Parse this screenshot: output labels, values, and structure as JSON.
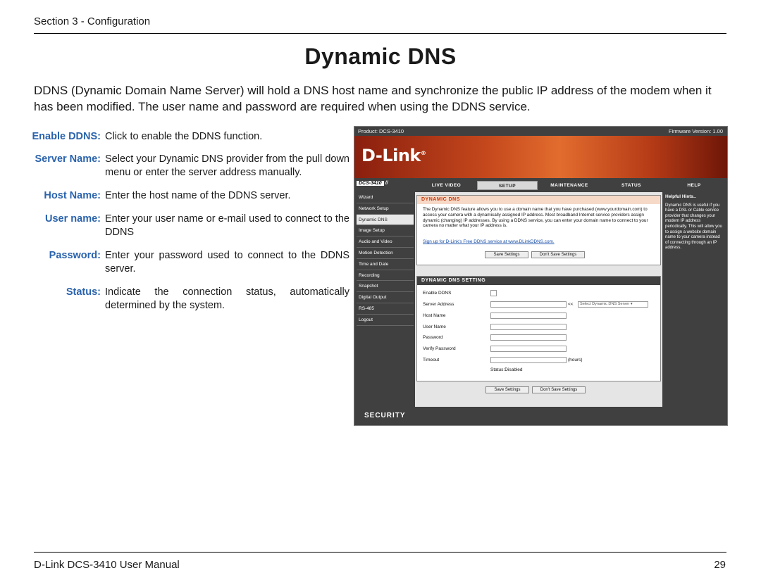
{
  "header": {
    "section": "Section 3 - Configuration"
  },
  "title": "Dynamic DNS",
  "intro": "DDNS (Dynamic Domain Name Server) will hold a DNS host name and synchronize the public IP address of the modem when it has been modified. The user name and password are required when using the DDNS service.",
  "fields": [
    {
      "label": "Enable DDNS:",
      "desc": "Click to enable the DDNS function."
    },
    {
      "label": "Server Name:",
      "desc": "Select your Dynamic DNS provider from the pull down menu or enter the server address manually."
    },
    {
      "label": "Host Name:",
      "desc": "Enter the host name of the DDNS server."
    },
    {
      "label": "User name:",
      "desc": "Enter your user name or e-mail used to connect to the DDNS"
    },
    {
      "label": "Password:",
      "desc": "Enter your password used to connect to the DDNS server."
    },
    {
      "label": "Status:",
      "desc": "Indicate the connection status, automatically determined by the system."
    }
  ],
  "screenshot": {
    "product": "Product: DCS-3410",
    "firmware": "Firmware Version: 1.00",
    "logo": "D-Link",
    "model": "DCS-3410",
    "tabs": [
      "LIVE VIDEO",
      "SETUP",
      "MAINTENANCE",
      "STATUS",
      "HELP"
    ],
    "sidebar": [
      "Wizard",
      "Network Setup",
      "Dynamic DNS",
      "Image Setup",
      "Audio and Video",
      "Motion Detection",
      "Time and Date",
      "Recording",
      "Snapshot",
      "Digital Output",
      "RS-485",
      "Logout"
    ],
    "panel_title": "DYNAMIC DNS",
    "panel_text": "The Dynamic DNS feature allows you to use a domain name that you have purchased (www.yourdomain.com) to access your camera with a dynamically assigned IP address. Most broadband Internet service providers assign dynamic (changing) IP addresses. By using a DDNS service, you can enter your domain name to connect to your camera no matter what your IP address is.",
    "signup_link": "Sign up for D-Link's Free DDNS service at www.DLinkDDNS.com.",
    "save_button": "Save Settings",
    "dont_save_button": "Don't Save Settings",
    "setting_title": "DYNAMIC DNS SETTING",
    "labels": {
      "enable": "Enable DDNS",
      "server": "Server Address",
      "host": "Host Name",
      "user": "User Name",
      "password": "Password",
      "verify": "Verify Password",
      "timeout": "Timeout"
    },
    "server_select": "Select Dynamic DNS Server",
    "arrows": "<<",
    "hours": "(hours)",
    "status": "Status:Disabled",
    "help_title": "Helpful Hints..",
    "help_text": "Dynamic DNS is useful if you have a DSL or Cable service provider that changes your modem IP address periodically. This will allow you to assign a website domain name to your camera instead of connecting through an IP address.",
    "footer_brand": "SECURITY"
  },
  "footer": {
    "left": "D-Link DCS-3410 User Manual",
    "page": "29"
  },
  "colors": {
    "label_blue": "#2a63ad",
    "dlink_orange": "#d9581f",
    "panel_title_orange": "#c23a0c",
    "chrome_dark": "#404040"
  }
}
